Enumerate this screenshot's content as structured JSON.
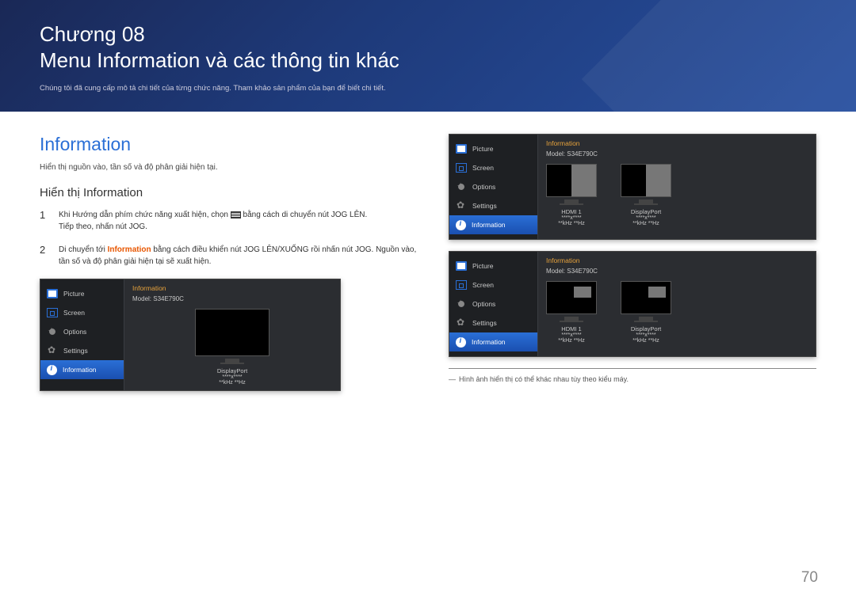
{
  "header": {
    "chapter": "Chương 08",
    "title": "Menu Information và các thông tin khác",
    "sub": "Chúng tôi đã cung cấp mô tả chi tiết của từng chức năng. Tham khảo sản phẩm của bạn để biết chi tiết."
  },
  "left": {
    "h1": "Information",
    "desc": "Hiển thị nguồn vào, tần số và độ phân giải hiện tại.",
    "h2": "Hiển thị Information",
    "step1a": "Khi Hướng dẫn phím chức năng xuất hiện, chọn ",
    "step1b": " bằng cách di chuyển nút JOG LÊN.",
    "step1c": "Tiếp theo, nhấn nút JOG.",
    "step2a": "Di chuyển tới ",
    "step2kw": "Information",
    "step2b": " bằng cách điều khiển nút JOG LÊN/XUỐNG rồi nhấn nút JOG. Nguồn vào, tần số và độ phân giải hiện tại sẽ xuất hiện."
  },
  "osd": {
    "menu": {
      "picture": "Picture",
      "screen": "Screen",
      "options": "Options",
      "settings": "Settings",
      "information": "Information"
    },
    "info_title": "Information",
    "model": "Model: S34E790C",
    "src1": "HDMI 1",
    "src2": "DisplayPort",
    "res": "****x****",
    "hz": "**kHz **Hz"
  },
  "footnote": "Hình ảnh hiển thị có thể khác nhau tùy theo kiểu máy.",
  "page_num": "70"
}
